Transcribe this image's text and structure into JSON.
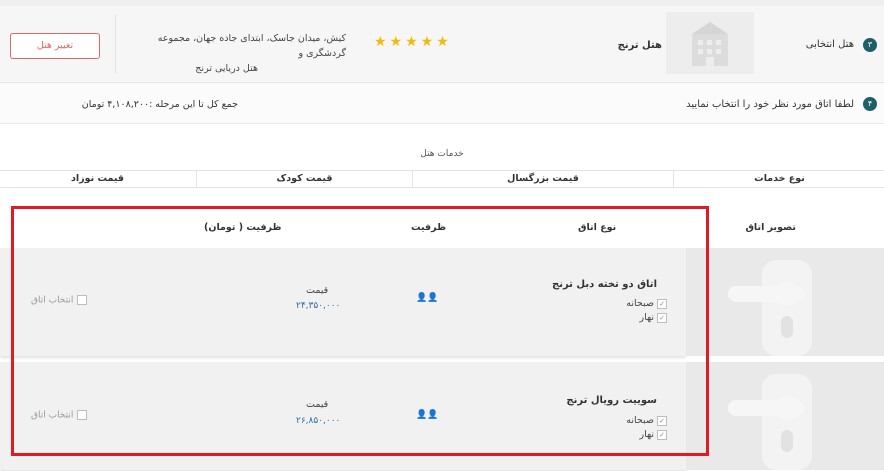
{
  "hotel_step": {
    "number": "۳",
    "label": "هتل انتخابی",
    "hotel_name": "هتل ترنج",
    "stars": "★★★★★",
    "address_line1": "کیش، میدان جاسک، ابتدای جاده جهان، مجموعه گردشگری و",
    "address_line2": "هتل دریایی ترنج",
    "change_button": "تغییر هتل"
  },
  "room_step": {
    "number": "۴",
    "label": "لطفا اتاق مورد نظر خود را انتخاب نمایید",
    "total_label": "جمع کل تا این مرحله :۴,۱۰۸,۲۰۰ تومان"
  },
  "services": {
    "title": "خدمات هتل",
    "headers": [
      "نوع خدمات",
      "قیمت بزرگسال",
      "قیمت کودک",
      "قیمت نوزاد"
    ]
  },
  "rooms_table": {
    "headers": {
      "image": "تصویر اتاق",
      "type": "نوع اتاق",
      "capacity": "ظرفیت",
      "price": "ظرفیت ( تومان)"
    },
    "rows": [
      {
        "name": "اتاق دو تخته دبل ترنج",
        "amenities": [
          "صبحانه",
          "نهار"
        ],
        "price_label": "قیمت",
        "price": "۲۴,۳۵۰,۰۰۰",
        "select_label": "انتخاب اتاق"
      },
      {
        "name": "سوییت رویال ترنج",
        "amenities": [
          "صبحانه",
          "نهار"
        ],
        "price_label": "قیمت",
        "price": "۲۶,۸۵۰,۰۰۰",
        "select_label": "انتخاب اتاق"
      }
    ]
  },
  "colors": {
    "step_badge": "#1f5f66",
    "stars": "#f3b90c",
    "change_button": "#e06666",
    "price": "#2e6da4",
    "highlight_frame": "#e01b24"
  }
}
